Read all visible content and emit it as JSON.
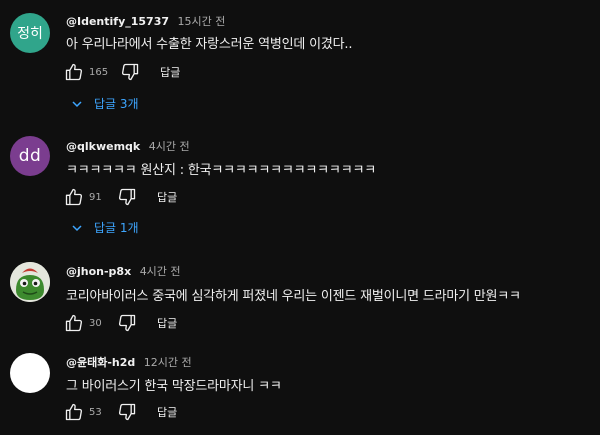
{
  "comments": [
    {
      "avatar_text": "정히",
      "author": "@Identify_15737",
      "time": "15시간 전",
      "text": "아 우리나라에서 수출한 자랑스러운 역병인데 이겼다..",
      "likes": "165",
      "reply_label": "답글",
      "replies_label": "답글 3개"
    },
    {
      "avatar_text": "dd",
      "author": "@qlkwemqk",
      "time": "4시간 전",
      "text": "ㅋㅋㅋㅋㅋㅋ 원산지 : 한국ㅋㅋㅋㅋㅋㅋㅋㅋㅋㅋㅋㅋㅋㅋ",
      "likes": "91",
      "reply_label": "답글",
      "replies_label": "답글 1개"
    },
    {
      "author": "@jhon-p8x",
      "time": "4시간 전",
      "text": "코리아바이러스 중국에 심각하게 퍼졌네 우리는 이젠드 재벌이니면 드라마기 만원ㅋㅋ",
      "likes": "30",
      "reply_label": "답글"
    },
    {
      "author": "@윤태화-h2d",
      "time": "12시간 전",
      "text": "그 바이러스기 한국 막장드라마자니 ㅋㅋ",
      "likes": "53",
      "reply_label": "답글"
    }
  ],
  "colors": {
    "background": "#0f0f0f",
    "link": "#3ea6ff",
    "muted": "#aaaaaa",
    "text": "#f1f1f1"
  },
  "icons": [
    "thumb-up-icon",
    "thumb-down-icon",
    "chevron-down-icon"
  ]
}
